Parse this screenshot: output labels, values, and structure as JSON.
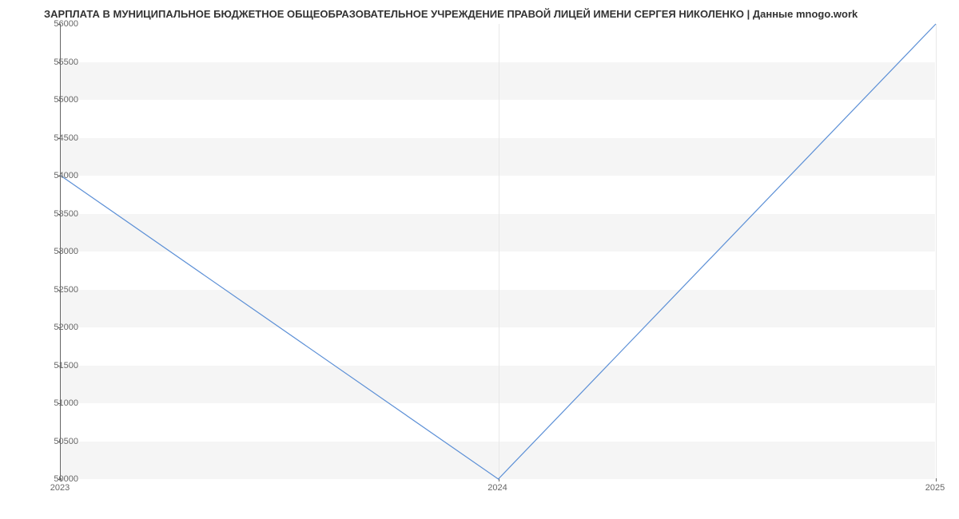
{
  "chart_data": {
    "type": "line",
    "title": "ЗАРПЛАТА В МУНИЦИПАЛЬНОЕ БЮДЖЕТНОЕ ОБЩЕОБРАЗОВАТЕЛЬНОЕ УЧРЕЖДЕНИЕ ПРАВОЙ ЛИЦЕЙ ИМЕНИ СЕРГЕЯ НИКОЛЕНКО | Данные mnogo.work",
    "x": [
      "2023",
      "2024",
      "2025"
    ],
    "values": [
      54000,
      50000,
      56000
    ],
    "xlabel": "",
    "ylabel": "",
    "ylim": [
      50000,
      56000
    ],
    "y_ticks": [
      50000,
      50500,
      51000,
      51500,
      52000,
      52500,
      53000,
      53500,
      54000,
      54500,
      55000,
      55500,
      56000
    ],
    "line_color": "#5b8fd6"
  }
}
